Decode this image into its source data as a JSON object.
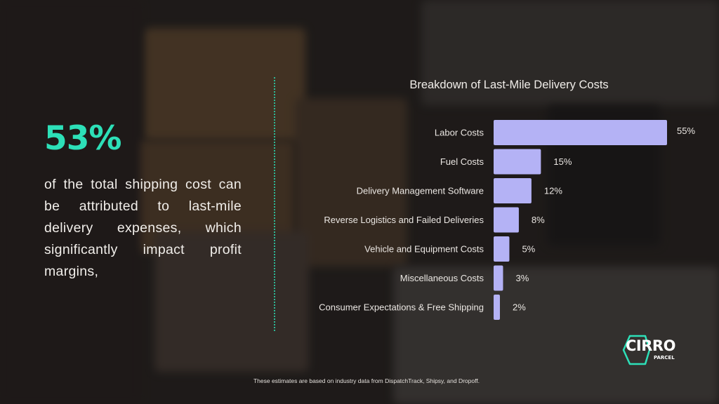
{
  "headline": {
    "stat": "53%",
    "text": "of the total shipping cost can be attributed to last-mile delivery expenses, which significantly impact profit margins,"
  },
  "footnote": "These estimates are based on industry data from DispatchTrack, Shipsy, and Dropoff.",
  "logo": {
    "word": "CIRRO",
    "sub": "PARCEL"
  },
  "colors": {
    "accent": "#2de0b8",
    "bar": "#b4b2f5",
    "text": "#f0ede9"
  },
  "chart_data": {
    "type": "bar",
    "orientation": "horizontal",
    "title": "Breakdown of Last-Mile Delivery Costs",
    "categories": [
      "Labor Costs",
      "Fuel Costs",
      "Delivery Management Software",
      "Reverse Logistics and Failed Deliveries",
      "Vehicle and Equipment Costs",
      "Miscellaneous Costs",
      "Consumer Expectations & Free Shipping"
    ],
    "values": [
      55,
      15,
      12,
      8,
      5,
      3,
      2
    ],
    "value_labels": [
      "55%",
      "15%",
      "12%",
      "8%",
      "5%",
      "3%",
      "2%"
    ],
    "xlabel": "",
    "ylabel": "",
    "xlim": [
      0,
      55
    ],
    "grid": false,
    "legend": "none",
    "unit": "%"
  }
}
